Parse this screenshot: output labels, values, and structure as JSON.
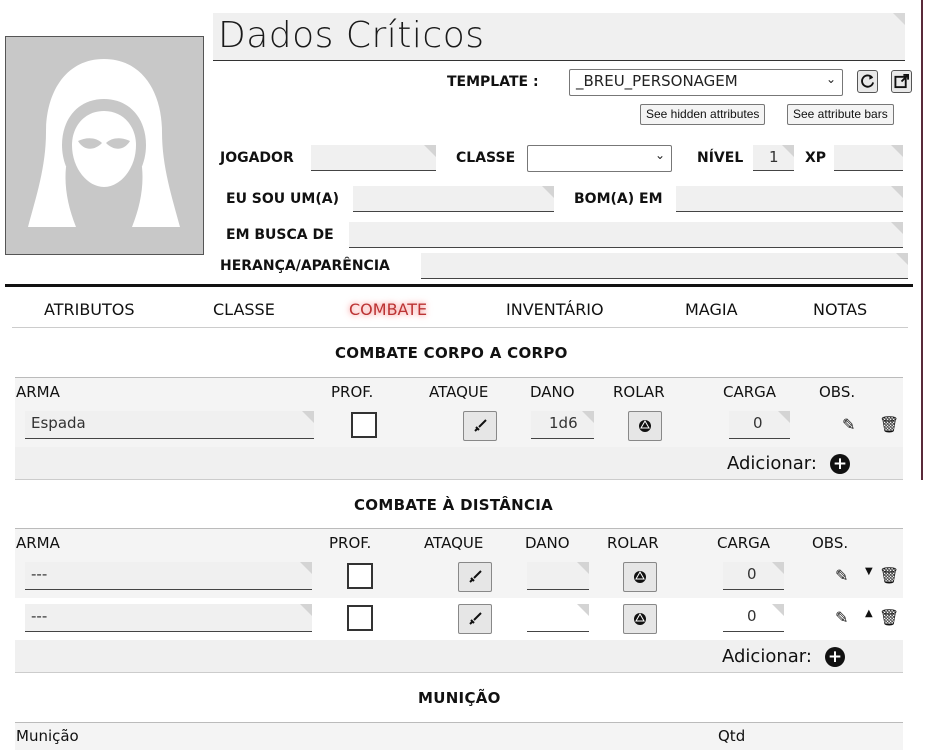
{
  "character": {
    "name": "Dados Críticos"
  },
  "template": {
    "label": "TEMPLATE :",
    "selected": "_BREU_PERSONAGEM"
  },
  "buttons": {
    "hidden_attrs": "See hidden attributes",
    "attr_bars": "See attribute bars"
  },
  "info": {
    "jogador_label": "JOGADOR",
    "jogador_value": "",
    "classe_label": "CLASSE",
    "classe_value": "",
    "nivel_label": "NÍVEL",
    "nivel_value": "1",
    "xp_label": "XP",
    "xp_value": "",
    "eu_sou_label": "EU SOU UM(A)",
    "eu_sou_value": "",
    "bom_em_label": "BOM(A) EM",
    "bom_em_value": "",
    "em_busca_label": "EM BUSCA DE",
    "em_busca_value": "",
    "heranca_label": "HERANÇA/APARÊNCIA",
    "heranca_value": ""
  },
  "tabs": [
    {
      "label": "ATRIBUTOS"
    },
    {
      "label": "CLASSE"
    },
    {
      "label": "COMBATE",
      "active": true
    },
    {
      "label": "INVENTÁRIO"
    },
    {
      "label": "MAGIA"
    },
    {
      "label": "NOTAS"
    }
  ],
  "melee": {
    "title": "COMBATE CORPO A CORPO",
    "headers": {
      "arma": "ARMA",
      "prof": "PROF.",
      "ataque": "ATAQUE",
      "dano": "DANO",
      "rolar": "ROLAR",
      "carga": "CARGA",
      "obs": "OBS."
    },
    "rows": [
      {
        "arma": "Espada",
        "dano": "1d6",
        "carga": "0"
      }
    ],
    "add_label": "Adicionar:"
  },
  "ranged": {
    "title": "COMBATE À DISTÂNCIA",
    "headers": {
      "arma": "ARMA",
      "prof": "PROF.",
      "ataque": "ATAQUE",
      "dano": "DANO",
      "rolar": "ROLAR",
      "carga": "CARGA",
      "obs": "OBS."
    },
    "rows": [
      {
        "arma": "---",
        "dano": "",
        "carga": "0"
      },
      {
        "arma": "---",
        "dano": "",
        "carga": "0"
      }
    ],
    "add_label": "Adicionar:"
  },
  "ammo": {
    "title": "MUNIÇÃO",
    "headers": {
      "municao": "Munição",
      "qtd": "Qtd"
    }
  },
  "icons": {
    "portrait": "hooded-figure-icon",
    "refresh": "refresh-icon",
    "popout": "popout-icon",
    "sword": "sword-icon",
    "dice": "d20-icon",
    "edit": "edit-icon",
    "trash": "trash-icon",
    "move_down": "move-down-icon",
    "move_up": "move-up-icon",
    "add": "plus-circle-icon"
  },
  "colors": {
    "active_tab": "#b33333",
    "field_bg": "#f0f0f0",
    "portrait_bg": "#c8c8c8"
  }
}
